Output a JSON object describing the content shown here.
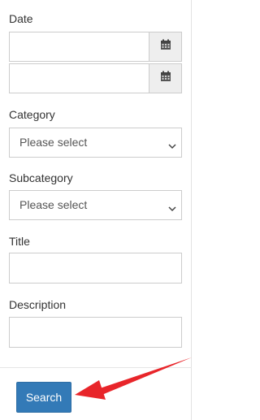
{
  "form": {
    "date_label": "Date",
    "category_label": "Category",
    "category_value": "Please select",
    "subcategory_label": "Subcategory",
    "subcategory_value": "Please select",
    "title_label": "Title",
    "description_label": "Description",
    "search_button": "Search"
  },
  "icons": {
    "date_addon": "calendar-icon",
    "select_caret": "chevron-down-icon",
    "annotation": "arrow"
  },
  "colors": {
    "primary": "#337ab7",
    "annotation": "#e8252a"
  }
}
